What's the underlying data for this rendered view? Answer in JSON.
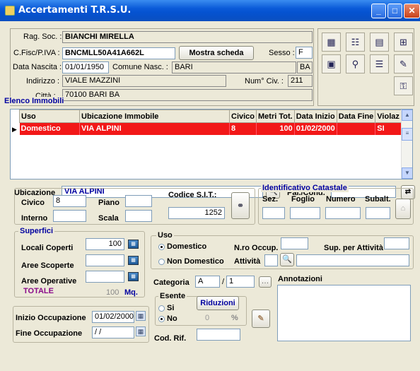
{
  "window": {
    "title": "Accertamenti T.R.S.U."
  },
  "header": {
    "rag_soc_label": "Rag. Soc. :",
    "rag_soc_value": "BIANCHI MIRELLA",
    "cf_label": "C.Fisc/P.IVA :",
    "cf_value": "BNCMLL50A41A662L",
    "mostra_scheda_label": "Mostra scheda",
    "sesso_label": "Sesso :",
    "sesso_value": "F",
    "data_nascita_label": "Data Nascita :",
    "data_nascita_value": "01/01/1950",
    "comune_nasc_label": "Comune Nasc. :",
    "comune_nasc_value": "BARI",
    "prov_value": "BA",
    "indirizzo_label": "Indirizzo :",
    "indirizzo_value": "VIALE MAZZINI",
    "num_civ_label": "Num° Civ. :",
    "num_civ_value": "211",
    "citta_label": "Città :",
    "citta_value": "70100 BARI BA"
  },
  "toolbar": {
    "icons": [
      "grid-icon",
      "card-icon",
      "form-icon",
      "network-icon",
      "calc-icon",
      "runner-icon",
      "list-icon",
      "edit-icon",
      "key-icon"
    ]
  },
  "elenco": {
    "title": "Elenco Immobili",
    "columns": [
      "Uso",
      "Ubicazione Immobile",
      "Civico",
      "Metri Tot.",
      "Data Inizio",
      "Data Fine",
      "Violaz"
    ],
    "rows": [
      {
        "uso": "Domestico",
        "ubicazione": "VIA ALPINI",
        "civico": "8",
        "metri": "100",
        "data_inizio": "01/02/2000",
        "data_fine": "",
        "violaz": "SI"
      }
    ]
  },
  "form": {
    "ubicazione_label": "Ubicazione",
    "ubicazione_value": "VIA ALPINI",
    "pal_cond_label": "Pal./Cond.",
    "civico_label": "Civico",
    "civico_value": "8",
    "piano_label": "Piano",
    "interno_label": "Interno",
    "scala_label": "Scala",
    "codice_sit_label": "Codice S.I.T.:",
    "codice_sit_value": "1252",
    "catastale_title": "Identificativo Catastale",
    "sez_label": "Sez.",
    "foglio_label": "Foglio",
    "numero_label": "Numero",
    "subalt_label": "Subalt.",
    "superfici_title": "Superfici",
    "locali_coperti_label": "Locali Coperti",
    "locali_coperti_value": "100",
    "aree_scoperte_label": "Aree Scoperte",
    "aree_operative_label": "Aree Operative",
    "totale_label": "TOTALE",
    "totale_value": "100",
    "mq_label": "Mq.",
    "uso_title": "Uso",
    "domestico_label": "Domestico",
    "non_domestico_label": "Non Domestico",
    "nro_occup_label": "N.ro Occup.",
    "sup_attivita_label": "Sup. per Attività",
    "attivita_label": "Attività",
    "categoria_label": "Categoria",
    "categoria_value": "A",
    "categoria_sep": "/",
    "categoria_value2": "1",
    "annotazioni_label": "Annotazioni",
    "esente_title": "Esente",
    "si_label": "Si",
    "no_label": "No",
    "riduzioni_label": "Riduzioni",
    "riduzioni_value": "0",
    "percent_label": "%",
    "inizio_occ_label": "Inizio Occupazione",
    "inizio_occ_value": "01/02/2000",
    "fine_occ_label": "Fine Occupazione",
    "fine_occ_value": " / /",
    "cod_rif_label": "Cod. Rif."
  }
}
